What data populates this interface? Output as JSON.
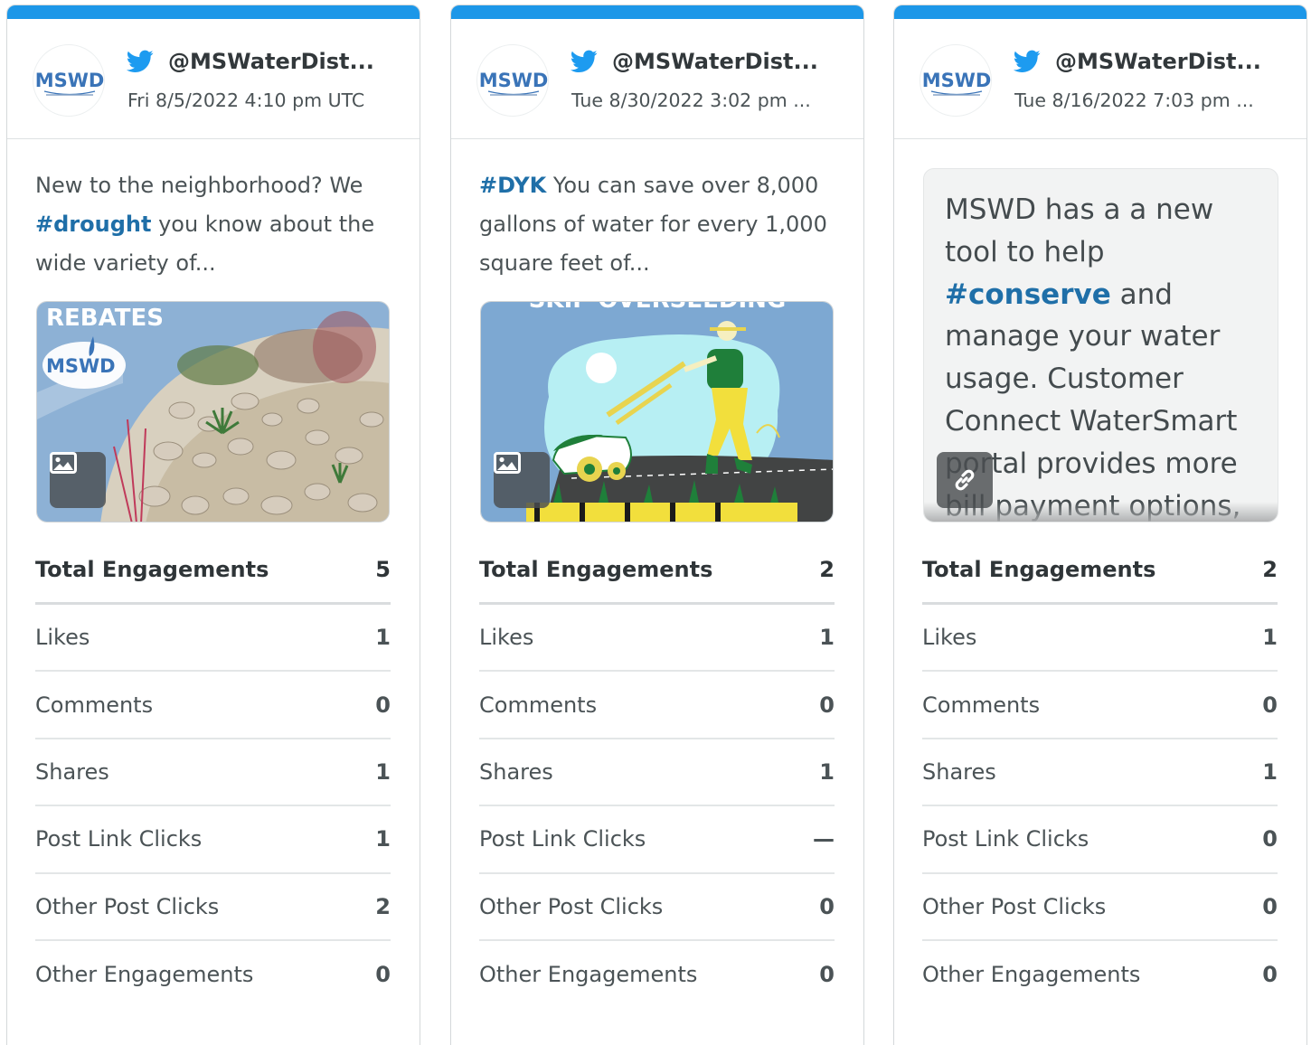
{
  "cards": [
    {
      "handle": "@MSWaterDist...",
      "timestamp": "Fri 8/5/2022 4:10 pm UTC",
      "avatar_text": "MSWD",
      "text_pre": "New to the neighborhood? We ",
      "hashtag": "#drought",
      "text_post": " you know about the wide variety of...",
      "media_type": "image",
      "media_overlay_text": "REBATES",
      "media_logo_text": "MSWD",
      "stats": [
        {
          "label": "Total Engagements",
          "value": "5"
        },
        {
          "label": "Likes",
          "value": "1"
        },
        {
          "label": "Comments",
          "value": "0"
        },
        {
          "label": "Shares",
          "value": "1"
        },
        {
          "label": "Post Link Clicks",
          "value": "1"
        },
        {
          "label": "Other Post Clicks",
          "value": "2"
        },
        {
          "label": "Other Engagements",
          "value": "0"
        }
      ]
    },
    {
      "handle": "@MSWaterDist...",
      "timestamp": "Tue 8/30/2022 3:02 pm ...",
      "avatar_text": "MSWD",
      "hashtag": "#DYK",
      "text_post": " You can save over 8,000 gallons of water for every 1,000 square feet of...",
      "media_type": "image",
      "media_overlay_text": "SKIP OVERSEEDING",
      "stats": [
        {
          "label": "Total Engagements",
          "value": "2"
        },
        {
          "label": "Likes",
          "value": "1"
        },
        {
          "label": "Comments",
          "value": "0"
        },
        {
          "label": "Shares",
          "value": "1"
        },
        {
          "label": "Post Link Clicks",
          "value": "—"
        },
        {
          "label": "Other Post Clicks",
          "value": "0"
        },
        {
          "label": "Other Engagements",
          "value": "0"
        }
      ]
    },
    {
      "handle": "@MSWaterDist...",
      "timestamp": "Tue 8/16/2022 7:03 pm ...",
      "avatar_text": "MSWD",
      "link_pre": "MSWD has a a new tool to help ",
      "hashtag": "#conserve",
      "link_post": " and manage your water usage. Customer Connect WaterSmart portal provides more bill payment options,",
      "media_type": "link",
      "stats": [
        {
          "label": "Total Engagements",
          "value": "2"
        },
        {
          "label": "Likes",
          "value": "1"
        },
        {
          "label": "Comments",
          "value": "0"
        },
        {
          "label": "Shares",
          "value": "1"
        },
        {
          "label": "Post Link Clicks",
          "value": "0"
        },
        {
          "label": "Other Post Clicks",
          "value": "0"
        },
        {
          "label": "Other Engagements",
          "value": "0"
        }
      ]
    }
  ],
  "icons": {
    "network": "twitter-bird-icon",
    "image_badge": "image-icon",
    "link_badge": "link-icon"
  },
  "colors": {
    "card_accent": "#1d97e8",
    "hashtag": "#1f6fa8",
    "twitter_blue": "#1d9bf0"
  }
}
